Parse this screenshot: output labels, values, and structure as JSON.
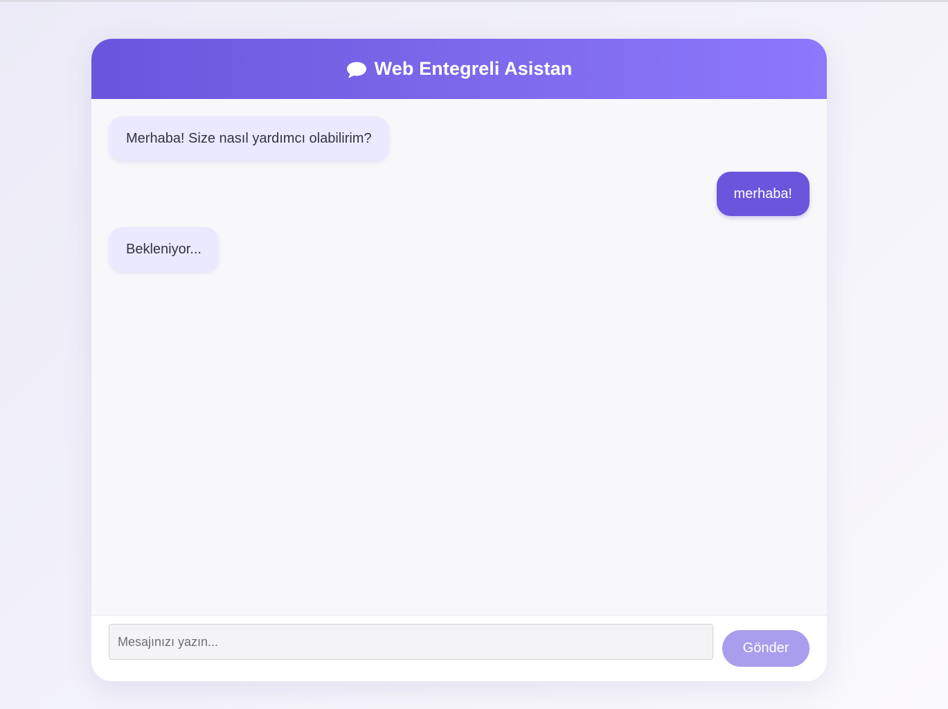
{
  "header": {
    "icon": "speech-bubble-icon",
    "title": "Web Entegreli Asistan"
  },
  "messages": [
    {
      "sender": "bot",
      "text": "Merhaba! Size nasıl yardımcı olabilirim?"
    },
    {
      "sender": "user",
      "text": "merhaba!"
    },
    {
      "sender": "bot",
      "text": "Bekleniyor..."
    }
  ],
  "composer": {
    "placeholder": "Mesajınızı yazın...",
    "value": "",
    "send_label": "Gönder"
  },
  "colors": {
    "accent": "#6b55dc",
    "header_gradient_start": "#6a56dd",
    "header_gradient_end": "#8d78fd",
    "bot_bubble": "#ebe9ff",
    "send_button": "#a99ded"
  }
}
